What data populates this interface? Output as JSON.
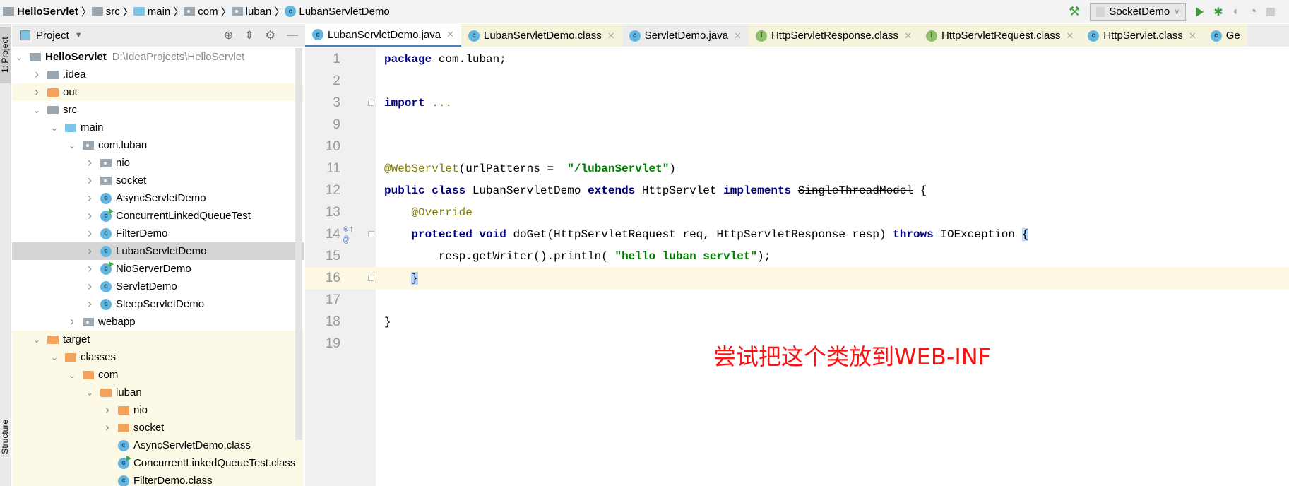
{
  "breadcrumb": [
    "HelloServlet",
    "src",
    "main",
    "com",
    "luban",
    "LubanServletDemo"
  ],
  "run_config": "SocketDemo",
  "left_strip": {
    "project": "1: Project",
    "structure": "Structure"
  },
  "panel": {
    "title": "Project"
  },
  "tree": [
    {
      "label": "HelloServlet",
      "path": "D:\\IdeaProjects\\HelloServlet",
      "level": 0,
      "icon": "module",
      "open": true
    },
    {
      "label": ".idea",
      "level": 1,
      "icon": "folder",
      "open": false
    },
    {
      "label": "out",
      "level": 1,
      "icon": "folder-orange",
      "open": false,
      "hl": true
    },
    {
      "label": "src",
      "level": 1,
      "icon": "folder",
      "open": true
    },
    {
      "label": "main",
      "level": 2,
      "icon": "folder-blue",
      "open": true
    },
    {
      "label": "com.luban",
      "level": 3,
      "icon": "package",
      "open": true
    },
    {
      "label": "nio",
      "level": 4,
      "icon": "package",
      "open": false
    },
    {
      "label": "socket",
      "level": 4,
      "icon": "package",
      "open": false
    },
    {
      "label": "AsyncServletDemo",
      "level": 4,
      "icon": "class",
      "open": false
    },
    {
      "label": "ConcurrentLinkedQueueTest",
      "level": 4,
      "icon": "class-run",
      "open": false
    },
    {
      "label": "FilterDemo",
      "level": 4,
      "icon": "class",
      "open": false
    },
    {
      "label": "LubanServletDemo",
      "level": 4,
      "icon": "class",
      "open": false,
      "selected": true
    },
    {
      "label": "NioServerDemo",
      "level": 4,
      "icon": "class-run",
      "open": false
    },
    {
      "label": "ServletDemo",
      "level": 4,
      "icon": "class",
      "open": false
    },
    {
      "label": "SleepServletDemo",
      "level": 4,
      "icon": "class",
      "open": false
    },
    {
      "label": "webapp",
      "level": 3,
      "icon": "package",
      "open": false
    },
    {
      "label": "target",
      "level": 1,
      "icon": "folder-orange",
      "open": true,
      "hl": true
    },
    {
      "label": "classes",
      "level": 2,
      "icon": "folder-orange",
      "open": true,
      "hl": true
    },
    {
      "label": "com",
      "level": 3,
      "icon": "folder-orange",
      "open": true,
      "hl": true
    },
    {
      "label": "luban",
      "level": 4,
      "icon": "folder-orange",
      "open": true,
      "hl": true
    },
    {
      "label": "nio",
      "level": 5,
      "icon": "folder-orange",
      "open": false,
      "hl": true
    },
    {
      "label": "socket",
      "level": 5,
      "icon": "folder-orange",
      "open": false,
      "hl": true
    },
    {
      "label": "AsyncServletDemo.class",
      "level": 5,
      "icon": "class",
      "leaf": true,
      "hl": true
    },
    {
      "label": "ConcurrentLinkedQueueTest.class",
      "level": 5,
      "icon": "class-run",
      "leaf": true,
      "hl": true
    },
    {
      "label": "FilterDemo.class",
      "level": 5,
      "icon": "class",
      "leaf": true,
      "hl": true
    }
  ],
  "tabs": [
    {
      "label": "LubanServletDemo.java",
      "icon": "class",
      "active": true
    },
    {
      "label": "LubanServletDemo.class",
      "icon": "class",
      "y": true
    },
    {
      "label": "ServletDemo.java",
      "icon": "class"
    },
    {
      "label": "HttpServletResponse.class",
      "icon": "interface",
      "y": true
    },
    {
      "label": "HttpServletRequest.class",
      "icon": "interface",
      "y": true
    },
    {
      "label": "HttpServlet.class",
      "icon": "class",
      "y": true
    },
    {
      "label": "Ge",
      "icon": "class",
      "y": true
    }
  ],
  "code": [
    {
      "n": "1",
      "t": [
        [
          "kw",
          "package"
        ],
        [
          "",
          "com.luban;"
        ]
      ]
    },
    {
      "n": "2",
      "t": []
    },
    {
      "n": "3",
      "t": [
        [
          "kw",
          "import"
        ],
        [
          "",
          ""
        ],
        [
          "an",
          "..."
        ]
      ],
      "fold": true
    },
    {
      "n": "9",
      "t": []
    },
    {
      "n": "10",
      "t": []
    },
    {
      "n": "11",
      "t": [
        [
          "an",
          "@WebServlet"
        ],
        [
          "",
          "(urlPatterns = "
        ],
        [
          "st",
          "\"/lubanServlet\""
        ],
        [
          "",
          ")"
        ]
      ]
    },
    {
      "n": "12",
      "t": [
        [
          "kw",
          "public class"
        ],
        [
          "",
          "LubanServletDemo"
        ],
        [
          "kw",
          "extends"
        ],
        [
          "",
          "HttpServlet"
        ],
        [
          "kw",
          "implements"
        ],
        [
          "strike",
          "SingleThreadModel"
        ],
        [
          "",
          "{"
        ]
      ]
    },
    {
      "n": "13",
      "t": [
        [
          "",
          "    "
        ],
        [
          "an",
          "@Override"
        ]
      ]
    },
    {
      "n": "14",
      "t": [
        [
          "",
          "    "
        ],
        [
          "kw",
          "protected void"
        ],
        [
          "",
          "doGet(HttpServletRequest req, HttpServletResponse resp)"
        ],
        [
          "kw",
          "throws"
        ],
        [
          "",
          "IOException"
        ],
        [
          "brace",
          "{"
        ]
      ],
      "marks": true,
      "fold": true
    },
    {
      "n": "15",
      "t": [
        [
          "",
          "        resp.getWriter().println("
        ],
        [
          "st",
          "\"hello luban servlet\""
        ],
        [
          "",
          ");"
        ]
      ]
    },
    {
      "n": "16",
      "t": [
        [
          "",
          "    "
        ],
        [
          "brace",
          "}"
        ]
      ],
      "cur": true,
      "fold": true
    },
    {
      "n": "17",
      "t": []
    },
    {
      "n": "18",
      "t": [
        [
          "",
          "}"
        ]
      ]
    },
    {
      "n": "19",
      "t": []
    }
  ],
  "annotation": "尝试把这个类放到WEB-INF",
  "colors": {
    "keyword": "#000080",
    "string": "#008000",
    "annotation": "#808000",
    "note": "#ff1111"
  }
}
